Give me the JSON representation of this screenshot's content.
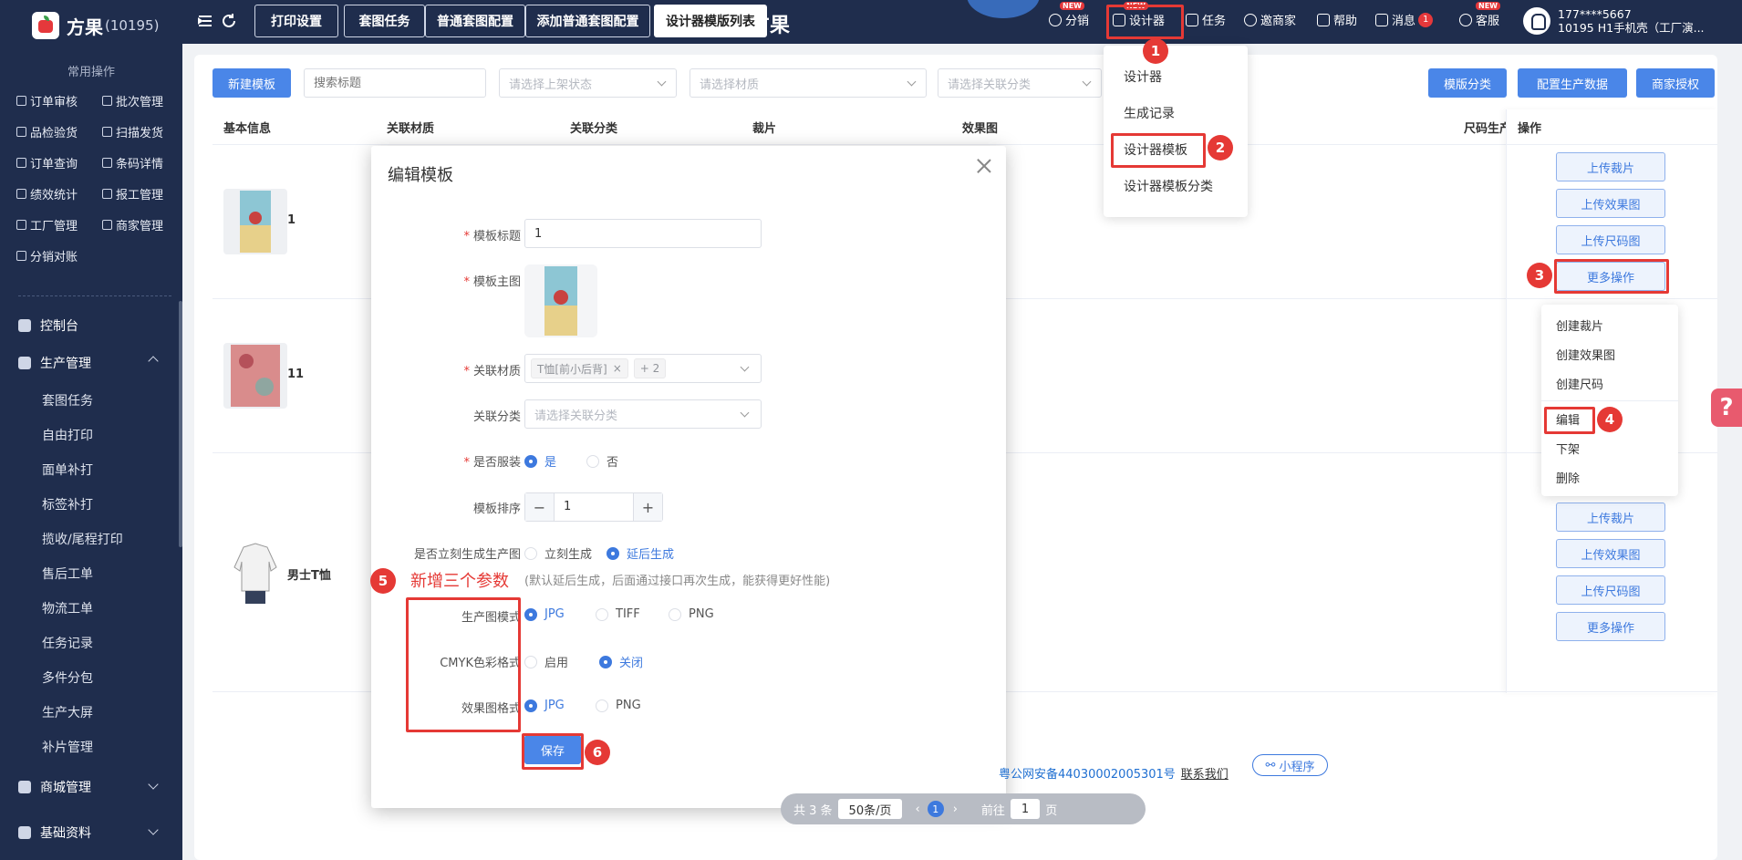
{
  "brand": {
    "name": "方果",
    "count": "(10195)"
  },
  "sidebar": {
    "section_title": "常用操作",
    "quick": [
      "订单审核",
      "批次管理",
      "品检验货",
      "扫描发货",
      "订单查询",
      "条码详情",
      "绩效统计",
      "报工管理",
      "工厂管理",
      "商家管理",
      "分销对账"
    ],
    "menu_dashboard": "控制台",
    "menu_production": "生产管理",
    "production_items": [
      "套图任务",
      "自由打印",
      "面单补打",
      "标签补打",
      "揽收/尾程打印",
      "售后工单",
      "物流工单",
      "任务记录",
      "多件分包",
      "生产大屏",
      "补片管理"
    ],
    "menu_mall": "商城管理",
    "menu_base": "基础资料"
  },
  "tabs": [
    "打印设置",
    "套图任务",
    "普通套图配置",
    "添加普通套图配置",
    "设计器模版列表"
  ],
  "page_title": "方果",
  "topright": {
    "fenxiao": "分销",
    "designer": "设计器",
    "task": "任务",
    "invite": "邀商家",
    "help": "帮助",
    "messages": "消息",
    "msg_count": "1",
    "service": "客服",
    "new_badge": "NEW",
    "user_phone": "177****5667",
    "user_org": "10195  H1手机壳（工厂演..."
  },
  "toolbar": {
    "new_template": "新建模板",
    "search_placeholder": "搜索标题",
    "status_placeholder": "请选择上架状态",
    "material_placeholder": "请选择材质",
    "category_placeholder": "请选择关联分类",
    "template_category": "模版分类",
    "config_production": "配置生产数据",
    "merchant_auth": "商家授权"
  },
  "table": {
    "headers": [
      "基本信息",
      "关联材质",
      "关联分类",
      "裁片",
      "效果图",
      "尺码生产",
      "操作"
    ],
    "rows": [
      {
        "name": "1"
      },
      {
        "name": "11"
      },
      {
        "name": "男士T恤"
      }
    ],
    "op_buttons": [
      "上传裁片",
      "上传效果图",
      "上传尺码图",
      "更多操作"
    ]
  },
  "designer_menu": [
    "设计器",
    "生成记录",
    "设计器模板",
    "设计器模板分类"
  ],
  "more_menu": {
    "group1": [
      "创建裁片",
      "创建效果图",
      "创建尺码"
    ],
    "group2": [
      "编辑",
      "下架",
      "删除"
    ]
  },
  "steps": [
    "1",
    "2",
    "3",
    "4",
    "5",
    "6"
  ],
  "modal": {
    "title": "编辑模板",
    "label_title": "模板标题",
    "title_value": "1",
    "label_main_image": "模板主图",
    "label_material": "关联材质",
    "material_tag": "T恤[前小后背]",
    "material_more": "+ 2",
    "label_category": "关联分类",
    "category_placeholder": "请选择关联分类",
    "label_is_clothing": "是否服装",
    "yes": "是",
    "no": "否",
    "label_sort": "模板排序",
    "sort_value": "1",
    "label_generate_now": "是否立刻生成生产图",
    "gen_now": "立刻生成",
    "gen_later": "延后生成",
    "hint": "(默认延后生成，后面通过接口再次生成，能获得更好性能)",
    "annotation": "新增三个参数",
    "label_prod_mode": "生产图模式",
    "prod_opts": [
      "JPG",
      "TIFF",
      "PNG"
    ],
    "label_cmyk": "CMYK色彩格式",
    "cmyk_opts": [
      "启用",
      "关闭"
    ],
    "label_effect_fmt": "效果图格式",
    "effect_opts": [
      "JPG",
      "PNG"
    ],
    "save": "保存"
  },
  "footer": {
    "icp": "粤公网安备44030002005301号",
    "contact": "联系我们",
    "mini": "小程序"
  },
  "pager": {
    "total": "共 3 条",
    "size": "50条/页",
    "page": "1",
    "goto": "前往",
    "goto_page": "1",
    "page_unit": "页"
  },
  "colors": {
    "sidebar_bg": "#1f2d4d",
    "primary": "#4a86e8",
    "annotation": "#e53935"
  }
}
